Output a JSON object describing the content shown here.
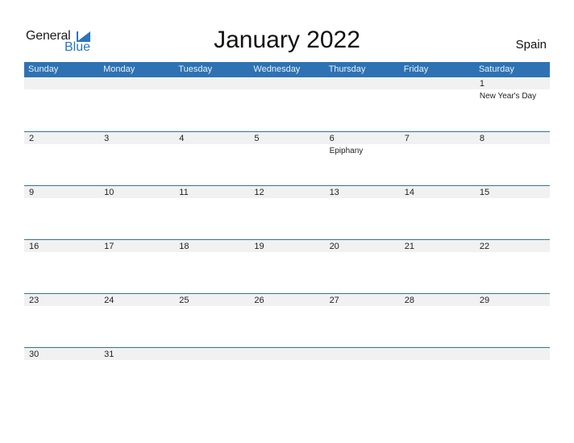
{
  "logo": {
    "general": "General",
    "blue": "Blue"
  },
  "title": "January 2022",
  "country": "Spain",
  "colors": {
    "header_bg": "#2e72b3",
    "strip_bg": "#f1f1f1",
    "brand_blue": "#2a75bb"
  },
  "weekdays": [
    "Sunday",
    "Monday",
    "Tuesday",
    "Wednesday",
    "Thursday",
    "Friday",
    "Saturday"
  ],
  "weeks": [
    [
      {
        "d": ""
      },
      {
        "d": ""
      },
      {
        "d": ""
      },
      {
        "d": ""
      },
      {
        "d": ""
      },
      {
        "d": ""
      },
      {
        "d": "1",
        "ev": "New Year's Day"
      }
    ],
    [
      {
        "d": "2"
      },
      {
        "d": "3"
      },
      {
        "d": "4"
      },
      {
        "d": "5"
      },
      {
        "d": "6",
        "ev": "Epiphany"
      },
      {
        "d": "7"
      },
      {
        "d": "8"
      }
    ],
    [
      {
        "d": "9"
      },
      {
        "d": "10"
      },
      {
        "d": "11"
      },
      {
        "d": "12"
      },
      {
        "d": "13"
      },
      {
        "d": "14"
      },
      {
        "d": "15"
      }
    ],
    [
      {
        "d": "16"
      },
      {
        "d": "17"
      },
      {
        "d": "18"
      },
      {
        "d": "19"
      },
      {
        "d": "20"
      },
      {
        "d": "21"
      },
      {
        "d": "22"
      }
    ],
    [
      {
        "d": "23"
      },
      {
        "d": "24"
      },
      {
        "d": "25"
      },
      {
        "d": "26"
      },
      {
        "d": "27"
      },
      {
        "d": "28"
      },
      {
        "d": "29"
      }
    ],
    [
      {
        "d": "30"
      },
      {
        "d": "31"
      },
      {
        "d": ""
      },
      {
        "d": ""
      },
      {
        "d": ""
      },
      {
        "d": ""
      },
      {
        "d": ""
      }
    ]
  ]
}
